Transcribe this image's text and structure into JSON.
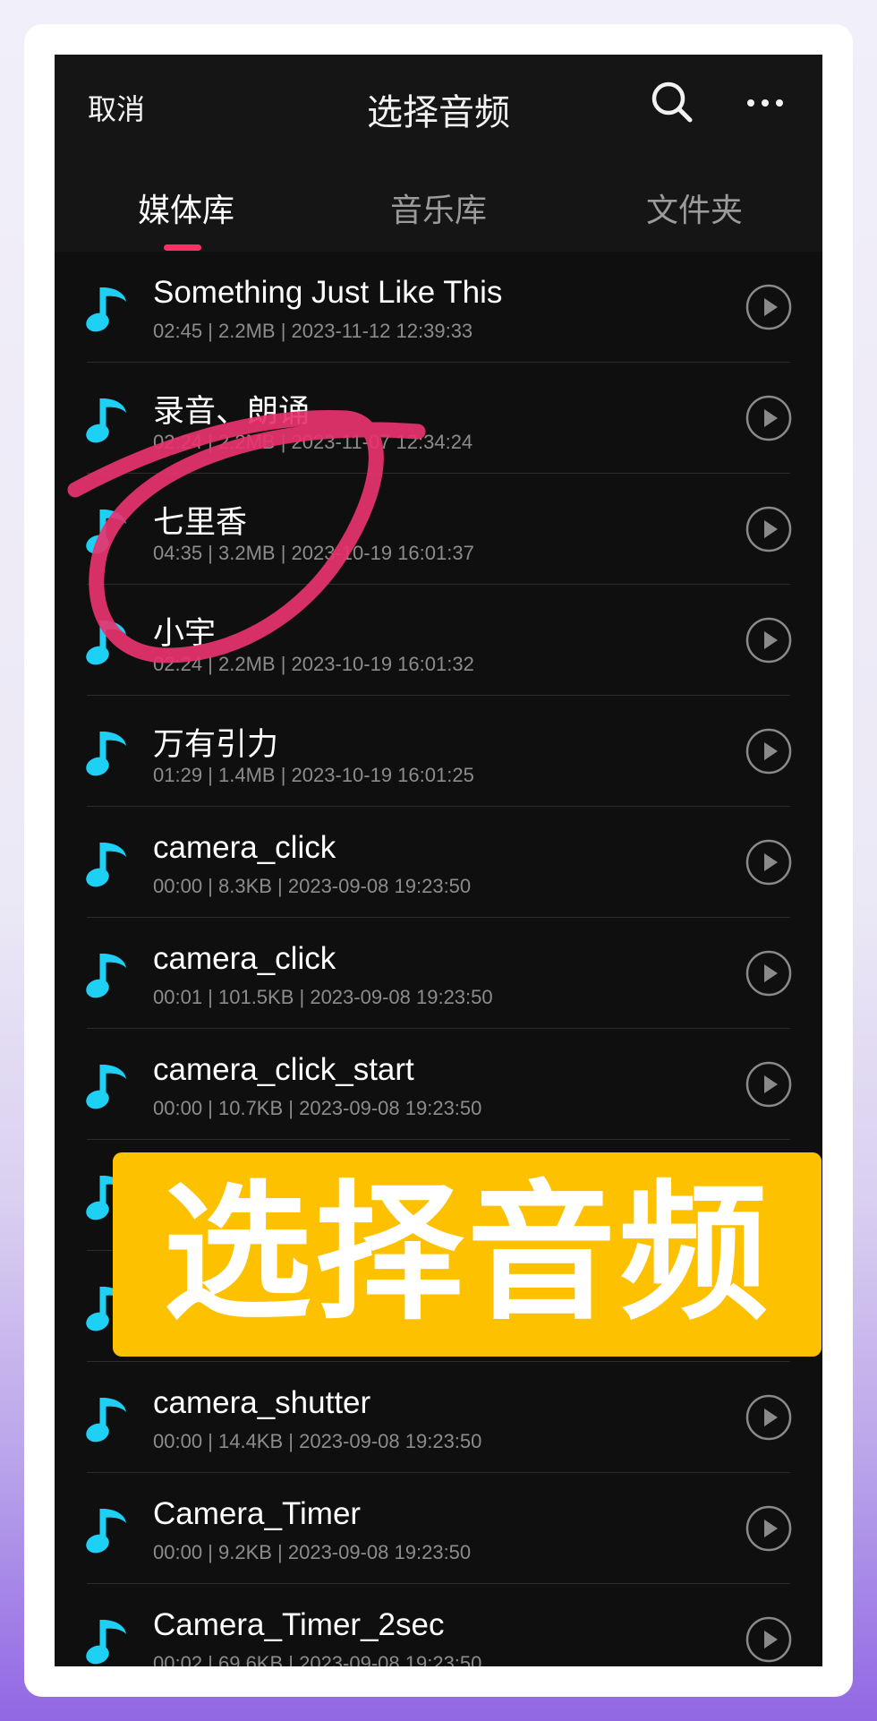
{
  "header": {
    "cancel_label": "取消",
    "title": "选择音频",
    "search_icon": "search-icon",
    "more_icon": "more-icon"
  },
  "tabs": [
    {
      "label": "媒体库",
      "active": true
    },
    {
      "label": "音乐库",
      "active": false
    },
    {
      "label": "文件夹",
      "active": false
    }
  ],
  "colors": {
    "accent": "#ff2e63",
    "note_icon": "#1fd0f5",
    "banner": "#fec100",
    "background": "#0f0f0f"
  },
  "list": [
    {
      "name": "Something Just Like This",
      "meta": "02:45 | 2.2MB | 2023-11-12 12:39:33"
    },
    {
      "name": "录音、朗诵",
      "meta": "02:24 | 2.2MB | 2023-11-07 12:34:24"
    },
    {
      "name": "七里香",
      "meta": "04:35 | 3.2MB | 2023-10-19 16:01:37"
    },
    {
      "name": "小宇",
      "meta": "02:24 | 2.2MB | 2023-10-19 16:01:32"
    },
    {
      "name": "万有引力",
      "meta": "01:29 | 1.4MB | 2023-10-19 16:01:25"
    },
    {
      "name": "camera_click",
      "meta": "00:00 | 8.3KB | 2023-09-08 19:23:50"
    },
    {
      "name": "camera_click",
      "meta": "00:01 | 101.5KB | 2023-09-08 19:23:50"
    },
    {
      "name": "camera_click_start",
      "meta": "00:00 | 10.7KB | 2023-09-08 19:23:50"
    },
    {
      "name": "",
      "meta": ""
    },
    {
      "name": "",
      "meta": ""
    },
    {
      "name": "camera_shutter",
      "meta": "00:00 | 14.4KB | 2023-09-08 19:23:50"
    },
    {
      "name": "Camera_Timer",
      "meta": "00:00 | 9.2KB | 2023-09-08 19:23:50"
    },
    {
      "name": "Camera_Timer_2sec",
      "meta": "00:02 | 69.6KB | 2023-09-08 19:23:50"
    }
  ],
  "banner": {
    "text": "选择音频"
  }
}
